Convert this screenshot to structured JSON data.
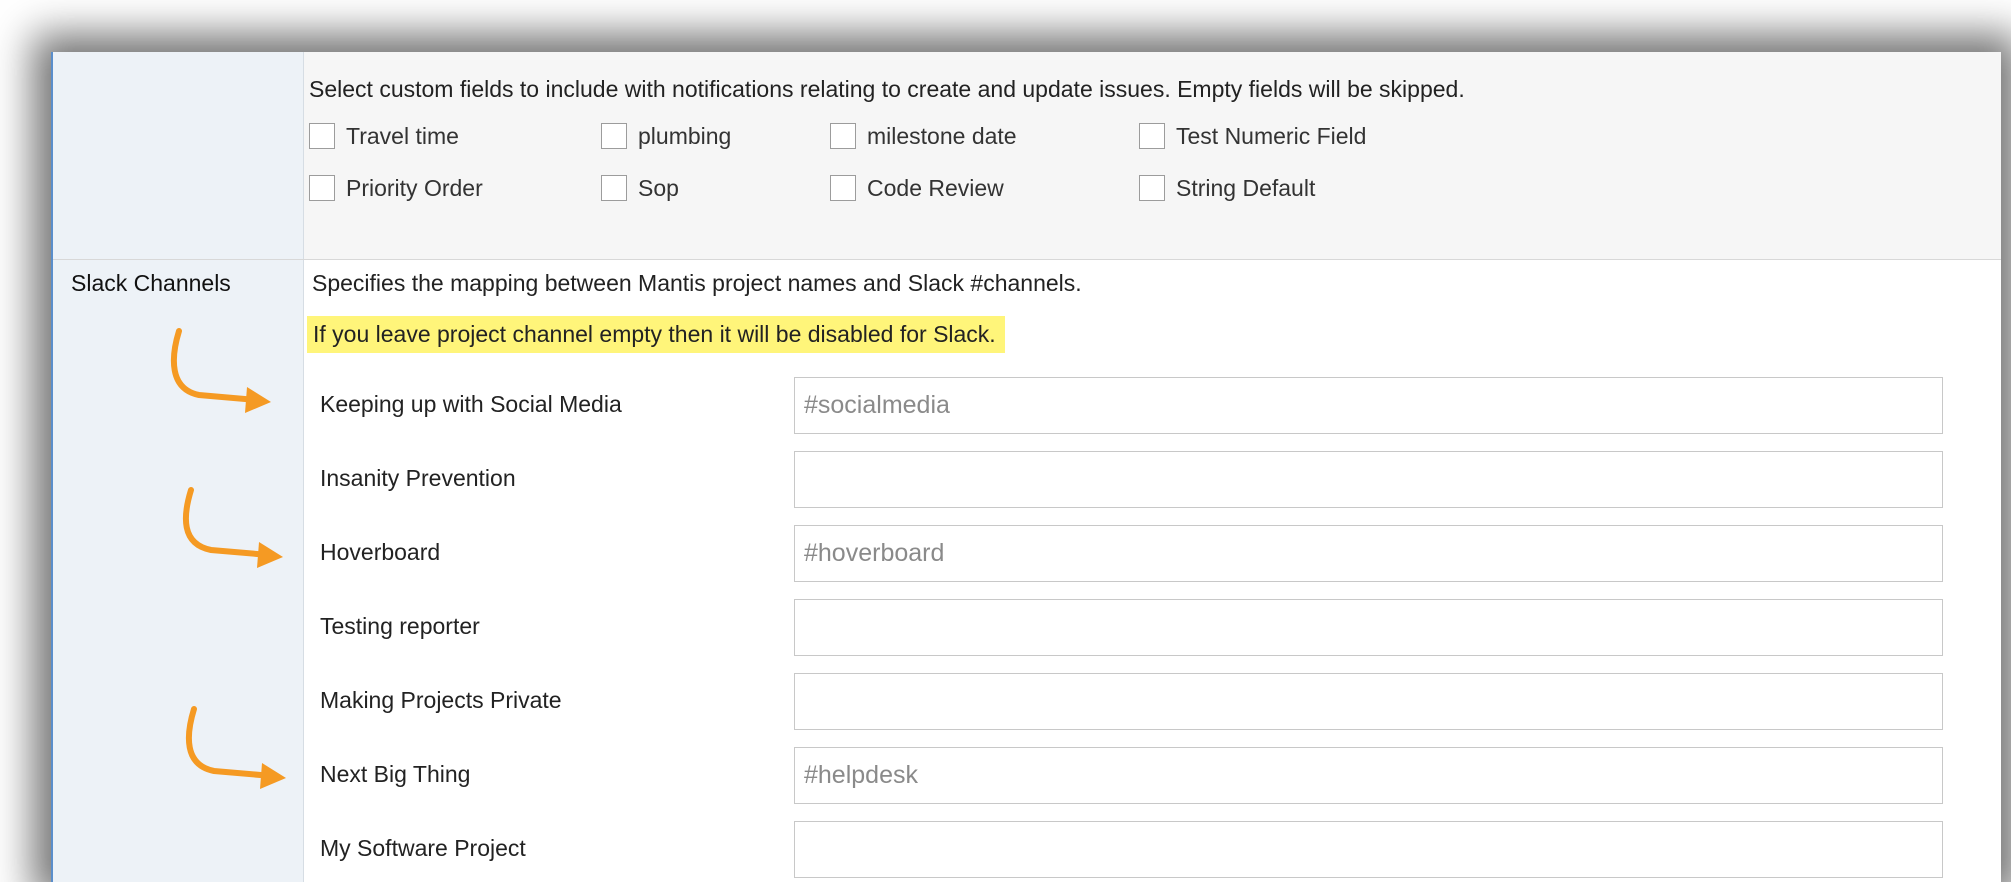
{
  "custom_fields": {
    "description": "Select custom fields to include with notifications relating to create and update issues. Empty fields will be skipped.",
    "options": [
      {
        "label": "Travel time",
        "checked": false
      },
      {
        "label": "plumbing",
        "checked": false
      },
      {
        "label": "milestone date",
        "checked": false
      },
      {
        "label": "Test Numeric Field",
        "checked": false
      },
      {
        "label": "Priority Order",
        "checked": false
      },
      {
        "label": "Sop",
        "checked": false
      },
      {
        "label": "Code Review",
        "checked": false
      },
      {
        "label": "String Default",
        "checked": false
      }
    ]
  },
  "slack_channels": {
    "label": "Slack Channels",
    "description": "Specifies the mapping between Mantis project names and Slack #channels.",
    "note": "If you leave project channel empty then it will be disabled for Slack.",
    "projects": [
      {
        "name": "Keeping up with Social Media",
        "channel_placeholder": "#socialmedia",
        "channel_value": ""
      },
      {
        "name": "Insanity Prevention",
        "channel_placeholder": "",
        "channel_value": ""
      },
      {
        "name": "Hoverboard",
        "channel_placeholder": "#hoverboard",
        "channel_value": ""
      },
      {
        "name": "Testing reporter",
        "channel_placeholder": "",
        "channel_value": ""
      },
      {
        "name": "Making Projects Private",
        "channel_placeholder": "",
        "channel_value": ""
      },
      {
        "name": "Next Big Thing",
        "channel_placeholder": "#helpdesk",
        "channel_value": ""
      },
      {
        "name": "My Software Project",
        "channel_placeholder": "",
        "channel_value": ""
      }
    ]
  },
  "annotations": {
    "arrow_color": "#f59a23",
    "arrow_icon": "curved-arrow-right-icon"
  }
}
